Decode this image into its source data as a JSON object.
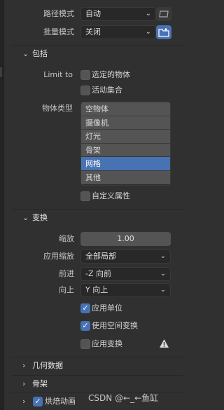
{
  "top": {
    "path_mode": {
      "label": "路径模式",
      "value": "自动"
    },
    "batch_mode": {
      "label": "批量模式",
      "value": "关闭"
    }
  },
  "include": {
    "title": "包括",
    "limit_to": {
      "label": "Limit to",
      "options": [
        {
          "label": "选定的物体",
          "checked": false
        },
        {
          "label": "活动集合",
          "checked": false
        }
      ]
    },
    "object_types": {
      "label": "物体类型",
      "items": [
        "空物体",
        "摄像机",
        "灯光",
        "骨架",
        "网格",
        "其他"
      ],
      "selected": "网格"
    },
    "custom_props": {
      "label": "自定义属性",
      "checked": false
    }
  },
  "transform": {
    "title": "变换",
    "scale": {
      "label": "缩放",
      "value": "1.00"
    },
    "apply_scale": {
      "label": "应用缩放",
      "value": "全部局部"
    },
    "forward": {
      "label": "前进",
      "value": "-Z 向前"
    },
    "up": {
      "label": "向上",
      "value": "Y 向上"
    },
    "apply_unit": {
      "label": "应用单位",
      "checked": true
    },
    "use_space_transform": {
      "label": "使用空间变换",
      "checked": true
    },
    "apply_transform": {
      "label": "应用变换",
      "checked": false
    }
  },
  "sections": {
    "geometry": "几何数据",
    "armature": "骨架",
    "bake_anim": {
      "label": "烘焙动画",
      "checked": true
    }
  },
  "watermark": "CSDN @←_←鱼缸",
  "colors": {
    "accent": "#4772b3",
    "panel": "#303030",
    "field": "#282828",
    "warning": "#d8d8d8"
  }
}
